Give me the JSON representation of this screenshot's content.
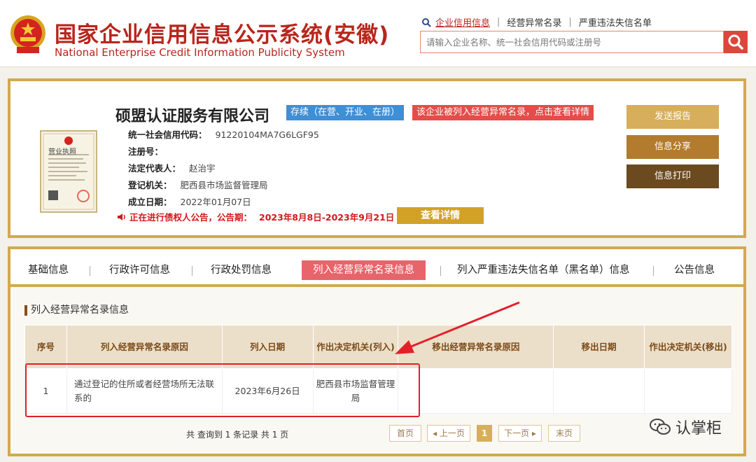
{
  "header": {
    "title": "国家企业信用信息公示系统(安徽)",
    "subtitle": "National Enterprise Credit Information Publicity System",
    "links": [
      "企业信用信息",
      "经营异常名录",
      "严重违法失信名单"
    ],
    "search_placeholder": "请输入企业名称、统一社会信用代码或注册号"
  },
  "company": {
    "name": "硕盟认证服务有限公司",
    "status_badge": "存续（在营、开业、在册）",
    "abnormal_badge": "该企业被列入经营异常名录，点击查看详情",
    "fields": [
      {
        "label": "统一社会信用代码：",
        "value": "91220104MA7G6LGF95"
      },
      {
        "label": "注册号：",
        "value": ""
      },
      {
        "label": "法定代表人：",
        "value": "赵治宇"
      },
      {
        "label": "登记机关：",
        "value": "肥西县市场监督管理局"
      },
      {
        "label": "成立日期：",
        "value": "2022年01月07日"
      }
    ],
    "notice_text": "正在进行债权人公告，公告期：",
    "notice_date": "2023年8月8日-2023年9月21日",
    "detail_button": "查看详情",
    "license_caption": "营业执照"
  },
  "actions": {
    "report": "发送报告",
    "share": "信息分享",
    "print": "信息打印"
  },
  "tabs": [
    "基础信息",
    "行政许可信息",
    "行政处罚信息",
    "列入经营异常名录信息",
    "列入严重违法失信名单（黑名单）信息",
    "公告信息"
  ],
  "section": {
    "title": "列入经营异常名录信息",
    "headers": [
      "序号",
      "列入经营异常名录原因",
      "列入日期",
      "作出决定机关(列入)",
      "移出经营异常名录原因",
      "移出日期",
      "作出决定机关(移出)"
    ],
    "rows": [
      {
        "no": "1",
        "reason": "通过登记的住所或者经营场所无法联系的",
        "date": "2023年6月26日",
        "authority": "肥西县市场监督管理局",
        "remove_reason": "",
        "remove_date": "",
        "remove_authority": ""
      }
    ]
  },
  "pagination": {
    "summary": "共 查询到 1 条记录 共 1 页",
    "first": "首页",
    "prev": "◂ 上一页",
    "current": "1",
    "next": "下一页 ▸",
    "last": "末页"
  },
  "watermark": "认掌柜",
  "colors": {
    "brand_red": "#b8261c",
    "gold": "#d2a94e",
    "active_tab": "#e7646a",
    "status_blue": "#3f8fd6",
    "alert_red": "#e44d4a"
  }
}
